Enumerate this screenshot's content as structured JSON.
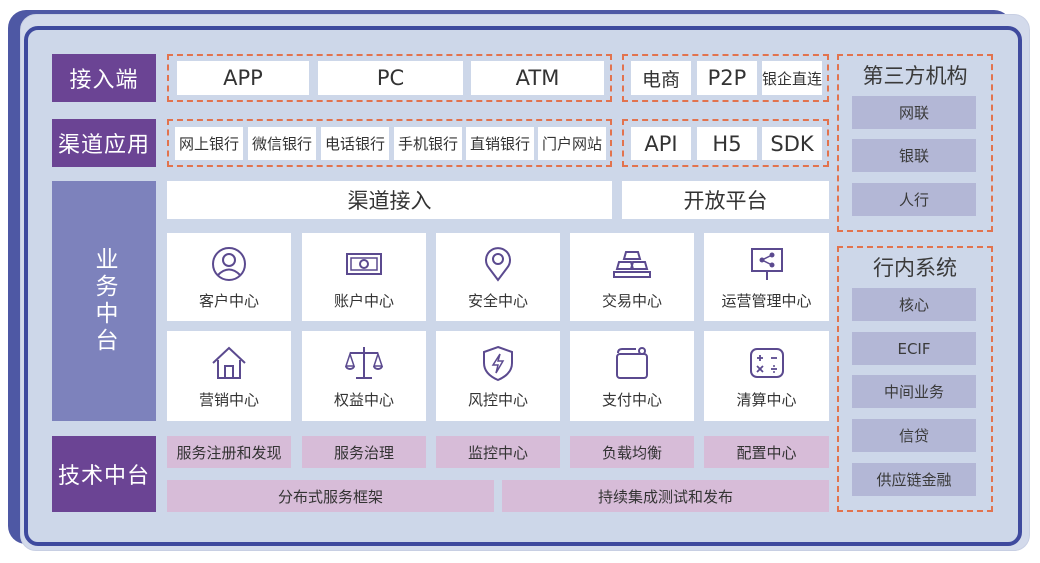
{
  "layers": {
    "access": "接入端",
    "channel_apps": "渠道应用",
    "business_platform": "业务中台",
    "tech_platform": "技术中台"
  },
  "access": {
    "group1": [
      "APP",
      "PC",
      "ATM"
    ],
    "group2": [
      "电商",
      "P2P",
      "银企直连"
    ]
  },
  "channel": {
    "group1": [
      "网上银行",
      "微信银行",
      "电话银行",
      "手机银行",
      "直销银行",
      "门户网站"
    ],
    "group2": [
      "API",
      "H5",
      "SDK"
    ]
  },
  "business": {
    "channel_access": "渠道接入",
    "open_platform": "开放平台",
    "centers": [
      {
        "label": "客户中心",
        "icon": "user-icon"
      },
      {
        "label": "账户中心",
        "icon": "banknote-icon"
      },
      {
        "label": "安全中心",
        "icon": "location-pin-icon"
      },
      {
        "label": "交易中心",
        "icon": "gold-bars-icon"
      },
      {
        "label": "运营管理中心",
        "icon": "presentation-share-icon"
      },
      {
        "label": "营销中心",
        "icon": "house-icon"
      },
      {
        "label": "权益中心",
        "icon": "scales-icon"
      },
      {
        "label": "风控中心",
        "icon": "shield-bolt-icon"
      },
      {
        "label": "支付中心",
        "icon": "wallet-icon"
      },
      {
        "label": "清算中心",
        "icon": "calculator-icon"
      }
    ]
  },
  "tech": {
    "row1": [
      "服务注册和发现",
      "服务治理",
      "监控中心",
      "负载均衡",
      "配置中心"
    ],
    "row2": [
      "分布式服务框架",
      "持续集成测试和发布"
    ]
  },
  "third_party": {
    "title": "第三方机构",
    "items": [
      "网联",
      "银联",
      "人行"
    ]
  },
  "internal": {
    "title": "行内系统",
    "items": [
      "核心",
      "ECIF",
      "中间业务",
      "信贷",
      "供应链金融"
    ]
  },
  "colors": {
    "frame": "#3f4a9e",
    "layer_label": "#6b4494",
    "business_label": "#7d82bc",
    "dashed_border": "#e2734e",
    "tech_box": "#d7bcd8",
    "side_item": "#b3b7d6",
    "icon_stroke": "#5b4a8f"
  }
}
